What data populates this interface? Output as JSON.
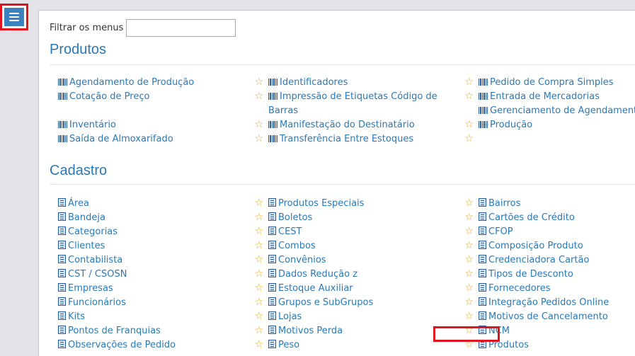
{
  "filter": {
    "label": "Filtrar os menus",
    "value": "",
    "placeholder": ""
  },
  "sections": [
    {
      "title": "Produtos",
      "icon": "barcode-icon",
      "columns": [
        [
          {
            "label": "Agendamento de Produção",
            "star": true
          },
          {
            "label": "Cotação de Preço",
            "star": true
          },
          {
            "label": "Inventário",
            "star": true
          },
          {
            "label": "Saída de Almoxarifado",
            "star": true
          }
        ],
        [
          {
            "label": "Identificadores",
            "star": true
          },
          {
            "label": "Impressão de Etiquetas Código de Barras",
            "star": true
          },
          {
            "label": "Manifestação do Destinatário",
            "star": true
          },
          {
            "label": "Transferência Entre Estoques",
            "star": true
          }
        ],
        [
          {
            "label": "Pedido de Compra Simples",
            "star": false
          },
          {
            "label": "Entrada de Mercadorias",
            "star": false
          },
          {
            "label": "Gerenciamento de Agendamento",
            "star": false
          },
          {
            "label": "Produção",
            "star": false
          }
        ]
      ]
    },
    {
      "title": "Cadastro",
      "icon": "form-icon",
      "columns": [
        [
          {
            "label": "Área",
            "star": true
          },
          {
            "label": "Bandeja",
            "star": true
          },
          {
            "label": "Categorias",
            "star": true
          },
          {
            "label": "Clientes",
            "star": true
          },
          {
            "label": "Contabilista",
            "star": true
          },
          {
            "label": "CST / CSOSN",
            "star": true
          },
          {
            "label": "Empresas",
            "star": true
          },
          {
            "label": "Funcionários",
            "star": true
          },
          {
            "label": "Kits",
            "star": true
          },
          {
            "label": "Pontos de Franquias",
            "star": true
          },
          {
            "label": "Observações de Pedido",
            "star": true
          }
        ],
        [
          {
            "label": "Produtos Especiais",
            "star": true
          },
          {
            "label": "Boletos",
            "star": true
          },
          {
            "label": "CEST",
            "star": true
          },
          {
            "label": "Combos",
            "star": true
          },
          {
            "label": "Convênios",
            "star": true
          },
          {
            "label": "Dados Redução z",
            "star": true
          },
          {
            "label": "Estoque Auxiliar",
            "star": true
          },
          {
            "label": "Grupos e SubGrupos",
            "star": true
          },
          {
            "label": "Lojas",
            "star": true
          },
          {
            "label": "Motivos Perda",
            "star": true
          },
          {
            "label": "Peso",
            "star": true
          }
        ],
        [
          {
            "label": "Bairros",
            "star": false
          },
          {
            "label": "Cartões de Crédito",
            "star": false
          },
          {
            "label": "CFOP",
            "star": false
          },
          {
            "label": "Composição Produto",
            "star": false
          },
          {
            "label": "Credenciadora Cartão",
            "star": false
          },
          {
            "label": "Tipos de Desconto",
            "star": false
          },
          {
            "label": "Fornecedores",
            "star": false
          },
          {
            "label": "Integração Pedidos Online",
            "star": false
          },
          {
            "label": "Motivos de Cancelamento",
            "star": false
          },
          {
            "label": "NCM",
            "star": false
          },
          {
            "label": "Produtos",
            "star": false
          }
        ]
      ]
    }
  ],
  "colors": {
    "accent": "#2a79b8",
    "star": "#e0a81e",
    "highlight": "#e0141e",
    "menu_button": "#3c82bf"
  }
}
